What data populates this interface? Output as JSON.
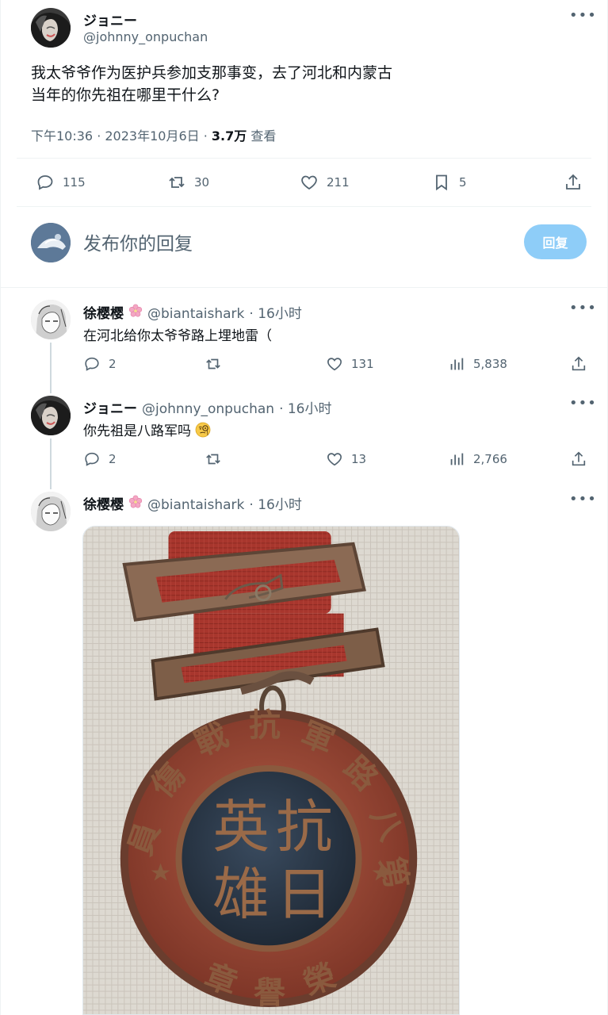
{
  "main_tweet": {
    "author_name": "ジョニー",
    "author_handle": "@johnny_onpuchan",
    "text_line1": "我太爷爷作为医护兵参加支那事变，去了河北和内蒙古",
    "text_line2": "当年的你先祖在哪里干什么?",
    "timestamp": "下午10:36 · 2023年10月6日 · ",
    "views_count": "3.7万",
    "views_label": "查看",
    "more_icon": "more-horizontal-icon",
    "stats": {
      "replies": "115",
      "retweets": "30",
      "likes": "211",
      "bookmarks": "5"
    }
  },
  "compose": {
    "placeholder": "发布你的回复",
    "button_label": "回复",
    "button_color": "#8ecdf8"
  },
  "replies": [
    {
      "author_name": "徐樱樱",
      "author_handle": "@biantaishark",
      "time": "· 16小时",
      "text": "在河北给你太爷爷路上埋地雷（",
      "replies": "2",
      "retweets": "",
      "likes": "131",
      "views": "5,838"
    },
    {
      "author_name": "ジョニー",
      "author_handle": "@johnny_onpuchan",
      "time": "· 16小时",
      "text": "你先祖是八路军吗",
      "emoji": "face-with-monocle",
      "replies": "2",
      "retweets": "",
      "likes": "13",
      "views": "2,766"
    },
    {
      "author_name": "徐樱樱",
      "author_handle": "@biantaishark",
      "time": "· 16小时",
      "media": {
        "medal_top_text": "第八路軍抗戰傷員",
        "medal_bottom_text": "榮譽章",
        "medal_center_text": "抗日英雄"
      }
    }
  ],
  "colors": {
    "text_primary": "#0f1419",
    "text_secondary": "#536471",
    "divider": "#eff3f4"
  }
}
